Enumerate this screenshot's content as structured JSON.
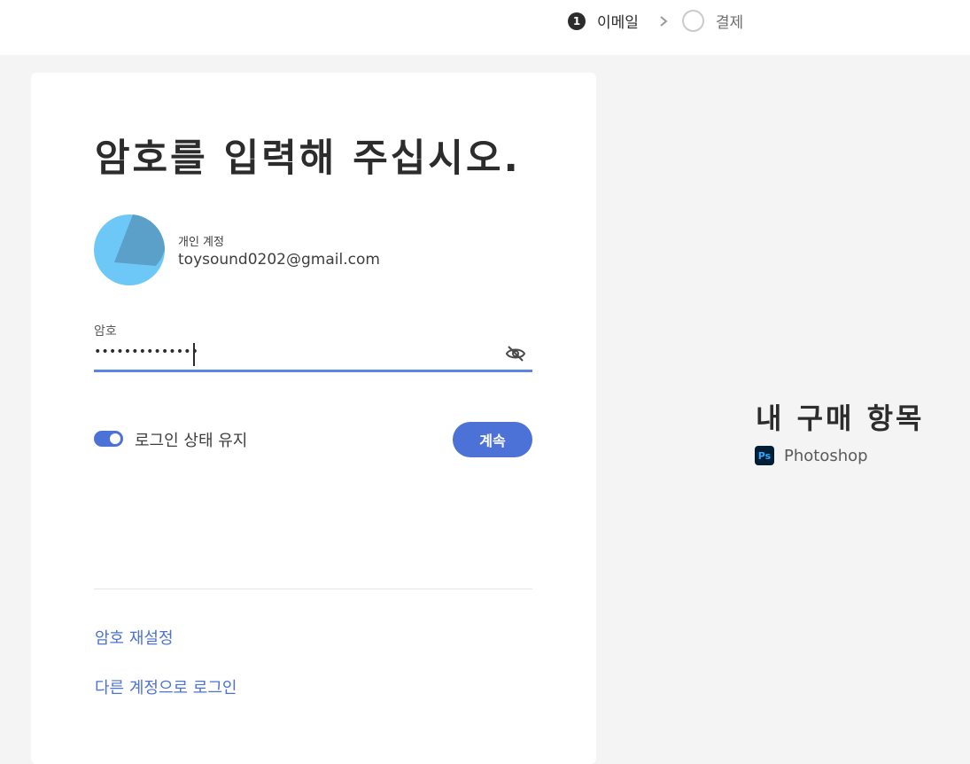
{
  "stepper": {
    "steps": [
      {
        "number": "1",
        "label": "이메일",
        "state": "active"
      },
      {
        "label": "결제",
        "state": "pending"
      }
    ]
  },
  "card": {
    "title": "암호를 입력해 주십시오.",
    "account": {
      "type_label": "개인 계정",
      "email": "toysound0202@gmail.com"
    },
    "password": {
      "label": "암호",
      "masked_value": "••••••••••••••"
    },
    "keep_signed_in": {
      "label": "로그인 상태 유지",
      "enabled": true
    },
    "continue_label": "계속",
    "links": {
      "reset_password": "암호 재설정",
      "other_account": "다른 계정으로 로그인"
    }
  },
  "summary": {
    "title": "내 구매 항목",
    "product": {
      "icon_text": "Ps",
      "name": "Photoshop"
    }
  },
  "colors": {
    "accent": "#4c72d8",
    "field_underline": "#5b86e0",
    "page_bg": "#f4f4f4",
    "avatar_light": "#6ec8f7",
    "avatar_dark": "#5aa0c8"
  }
}
